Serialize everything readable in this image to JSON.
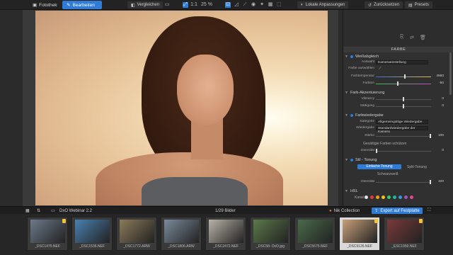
{
  "topbar": {
    "tabs": [
      {
        "label": "Fotothek",
        "icon": "library-icon"
      },
      {
        "label": "Bearbeiten",
        "icon": "edit-icon"
      }
    ],
    "compare_label": "Vergleichen",
    "zoom_ratio": "1:1",
    "zoom_percent": "25 %",
    "local_adjust_label": "Lokale Anpassungen",
    "reset_label": "Zurücksetzen",
    "presets_label": "Presets"
  },
  "panel": {
    "title": "FARBE",
    "sections": {
      "white_balance": {
        "title": "Weißabgleich",
        "mode_label": "Auswahl",
        "mode_value": "Kameraeinstellung",
        "picker_label": "Farbe auswählen",
        "temp_label": "Farbtemperatur",
        "temp_value": "4560",
        "tint_label": "Farbton",
        "tint_value": "-50"
      },
      "color_accent": {
        "title": "Farb-Akzentuierung",
        "vib_label": "Vibrancy",
        "vib_value": "0",
        "sat_label": "Sättigung",
        "sat_value": "0"
      },
      "color_rendering": {
        "title": "Farbwiedergabe",
        "cat_label": "Kategorie",
        "cat_value": "Allgemeingültige Wiedergabe",
        "rend_label": "Wiedergabe",
        "rend_value": "Standardwiedergabe der Kamera",
        "strength_label": "Stärke",
        "strength_value": "100",
        "protect_label": "Gesättigte Farben schützen",
        "intensity_label": "Intensität",
        "intensity_value": "0"
      },
      "style_toning": {
        "title": "Stil - Tonung",
        "simple_label": "Einfache Tonung",
        "split_label": "Split-Tonung",
        "bw_label": "Schwarzweiß",
        "intensity_label": "Intensität",
        "intensity_value": "100"
      },
      "hsl": {
        "title": "HSL",
        "channel_label": "Kanal",
        "colors": [
          "#e0e0e0",
          "#e53935",
          "#f39c12",
          "#f1c40f",
          "#2ecc71",
          "#1abc9c",
          "#3498db",
          "#9b59b6",
          "#e84393"
        ]
      }
    }
  },
  "filmstrip_bar": {
    "project_name": "DxO Webinar 2.2",
    "count_label": "1/29 Bilder",
    "nik_label": "Nik Collection",
    "export_label": "Export auf Festplatte"
  },
  "thumbnails": [
    {
      "name": "_DSC1475.NEF",
      "color": "#6c7a8a",
      "badge": true
    },
    {
      "name": "_DSC1536.NEF",
      "color": "#4a7fb0",
      "badge": false
    },
    {
      "name": "_DSC1772.ARW",
      "color": "#8a7a5a",
      "badge": false
    },
    {
      "name": "_DSC1806.ARW",
      "color": "#7a8a9a",
      "badge": false
    },
    {
      "name": "_DSC2472.NEF",
      "color": "#b8b2a8",
      "badge": false
    },
    {
      "name": "_DSC58- DxO.jpg",
      "color": "#5c7a4a",
      "badge": false
    },
    {
      "name": "_DSC5675.NEF",
      "color": "#4a6a4a",
      "badge": false
    },
    {
      "name": "_DSC9126.NEF",
      "color": "#c8a07a",
      "badge": true
    },
    {
      "name": "_ESC1950.NEF",
      "color": "#7a3a3a",
      "badge": true
    }
  ]
}
